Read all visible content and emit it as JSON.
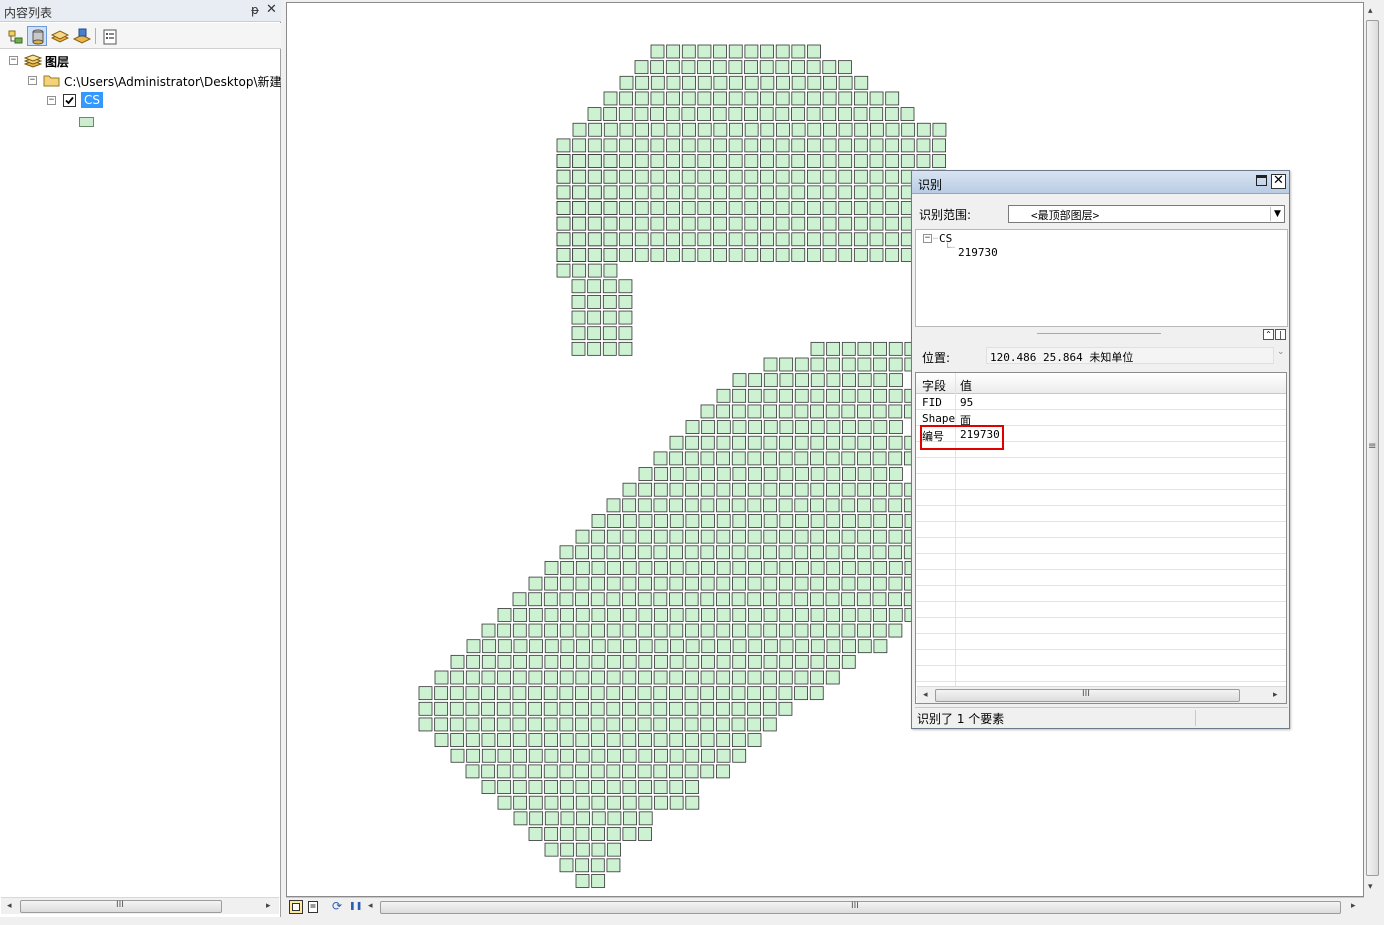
{
  "toc": {
    "title": "内容列表",
    "pin_glyph": "ᵽ",
    "close_glyph": "✕",
    "toolbar": [
      {
        "name": "list-by-drawing-order-icon"
      },
      {
        "name": "list-by-source-icon"
      },
      {
        "name": "list-by-visibility-icon"
      },
      {
        "name": "list-by-selection-icon"
      },
      {
        "name": "options-icon"
      }
    ],
    "tree": {
      "root_label": "图层",
      "folder_label": "C:\\Users\\Administrator\\Desktop\\新建",
      "layer_label": "CS",
      "layer_checked": true,
      "symbol_color": "#cdeccf"
    },
    "expander_glyph": "−",
    "scroll_grip": "III"
  },
  "map": {
    "fill_color": "#cdf2d2",
    "stroke_color": "#333333",
    "background": "#ffffff",
    "scroll_grip": "III"
  },
  "identify": {
    "title": "识别",
    "close_glyph": "✕",
    "scope_label": "识别范围:",
    "scope_value": "<最顶部图层>",
    "dropdown_glyph": "▼",
    "tree_layer": "CS",
    "tree_feature": "219730",
    "position_label": "位置:",
    "position_value": "120.486  25.864 未知单位",
    "columns": {
      "field": "字段",
      "value": "值"
    },
    "rows": [
      {
        "field": "FID",
        "value": "95"
      },
      {
        "field": "Shape",
        "value": "面"
      },
      {
        "field": "编号",
        "value": "219730"
      }
    ],
    "status": "识别了 1 个要素",
    "scroll_grip": "III",
    "highlight_color": "#e00000"
  },
  "icons": {
    "left_arrow": "◂",
    "right_arrow": "▸",
    "up_arrow": "▴",
    "down_arrow": "▾",
    "pause": "❚❚",
    "refresh": "⟳",
    "grip": "≡"
  }
}
